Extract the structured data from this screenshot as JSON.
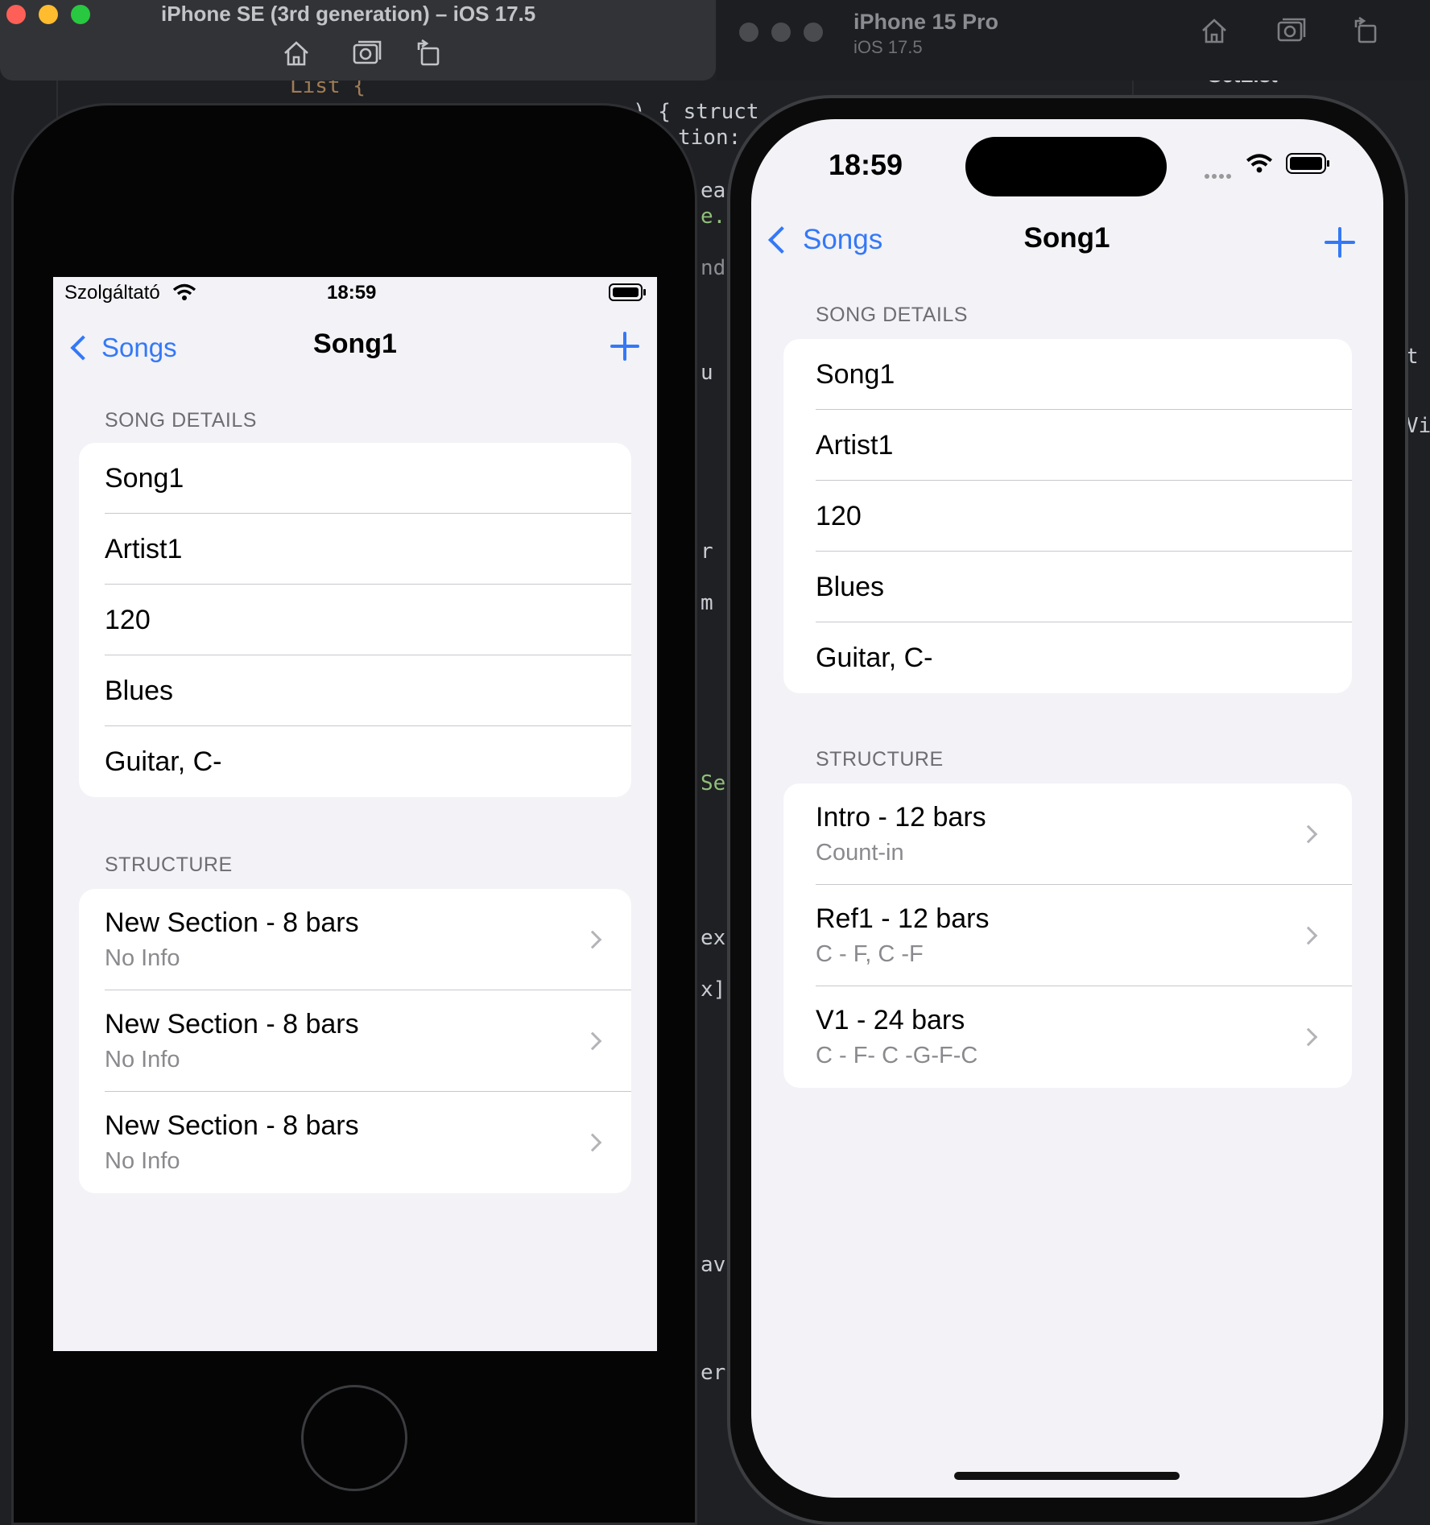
{
  "editor_fragments": {
    "line1": "List {",
    "line2": ") { struct",
    "line3": "tion:",
    "line4": "ea",
    "line5": "e.",
    "line6": "nd",
    "line7": "u",
    "line8": "r",
    "line9": "m",
    "line10": "Se",
    "line11": "ex",
    "line12": "x]",
    "line13": "av",
    "line14": "er",
    "right1": "SetList",
    "right2": "t",
    "right3": "Vie"
  },
  "simulator_se": {
    "window_title": "iPhone SE (3rd generation) – iOS 17.5",
    "status": {
      "carrier": "Szolgáltató",
      "time": "18:59"
    },
    "nav": {
      "back_label": "Songs",
      "title": "Song1"
    },
    "song_details_header": "SONG DETAILS",
    "song_details": [
      "Song1",
      "Artist1",
      "120",
      "Blues",
      "Guitar, C-"
    ],
    "structure_header": "STRUCTURE",
    "structure": [
      {
        "title": "New Section - 8 bars",
        "subtitle": "No Info"
      },
      {
        "title": "New Section - 8 bars",
        "subtitle": "No Info"
      },
      {
        "title": "New Section - 8 bars",
        "subtitle": "No Info"
      }
    ]
  },
  "simulator_pro": {
    "window_title": "iPhone 15 Pro",
    "window_subtitle": "iOS 17.5",
    "status": {
      "time": "18:59"
    },
    "nav": {
      "back_label": "Songs",
      "title": "Song1"
    },
    "song_details_header": "SONG DETAILS",
    "song_details": [
      "Song1",
      "Artist1",
      "120",
      "Blues",
      "Guitar, C-"
    ],
    "structure_header": "STRUCTURE",
    "structure": [
      {
        "title": "Intro - 12 bars",
        "subtitle": "Count-in"
      },
      {
        "title": "Ref1 - 12 bars",
        "subtitle": "C - F, C -F"
      },
      {
        "title": "V1 - 24 bars",
        "subtitle": "C - F- C -G-F-C"
      }
    ]
  },
  "colors": {
    "accent": "#3478f6",
    "grouped_bg": "#f2f2f7",
    "secondary_text": "#8a8a8e"
  }
}
